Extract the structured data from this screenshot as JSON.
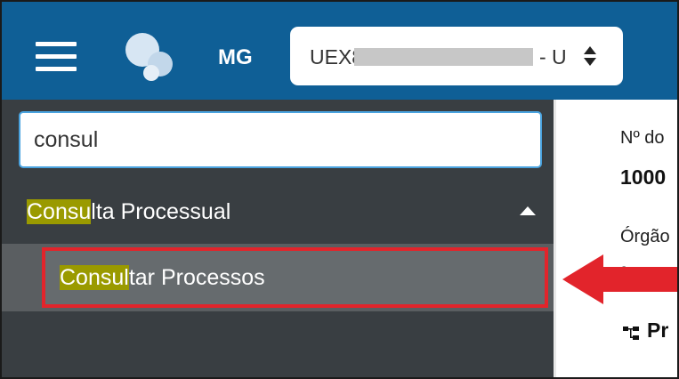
{
  "header": {
    "user": "MG",
    "unit_select": {
      "value_prefix": "UEX8",
      "value_suffix": "- U"
    }
  },
  "sidebar": {
    "search": {
      "value": "consul"
    },
    "group": {
      "highlight": "Consu",
      "rest": "lta Processual"
    },
    "submenu_item": {
      "highlight": "Consul",
      "rest": "tar Processos"
    }
  },
  "content": {
    "label1": "Nº do",
    "value1": "1000",
    "label2": "Órgão",
    "value2": "ª Va",
    "value3": "Pr"
  },
  "colors": {
    "header_bg": "#0f5f96",
    "sidebar_bg": "#393e42",
    "highlight": "#9a9a00",
    "annotation_red": "#e2242b",
    "input_focus": "#4aa3df"
  },
  "icons": {
    "menu": "hamburger-icon",
    "logo": "app-logo-icon",
    "select": "sort-icon",
    "expand": "caret-up-icon",
    "tree": "tree-icon",
    "annotation": "red-arrow"
  }
}
